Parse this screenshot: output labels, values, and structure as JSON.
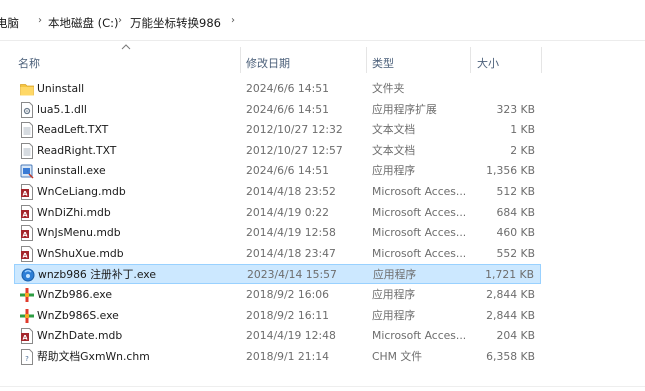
{
  "breadcrumb": [
    "电脑",
    "本地磁盘 (C:)",
    "万能坐标转换986"
  ],
  "columns": {
    "name": "名称",
    "date": "修改日期",
    "type": "类型",
    "size": "大小"
  },
  "files": [
    {
      "name": "Uninstall",
      "date": "2024/6/6 14:51",
      "type": "文件夹",
      "size": "",
      "icon": "folder-icon"
    },
    {
      "name": "lua5.1.dll",
      "date": "2024/6/6 14:51",
      "type": "应用程序扩展",
      "size": "323 KB",
      "icon": "dll-icon"
    },
    {
      "name": "ReadLeft.TXT",
      "date": "2012/10/27 12:32",
      "type": "文本文档",
      "size": "1 KB",
      "icon": "text-file-icon"
    },
    {
      "name": "ReadRight.TXT",
      "date": "2012/10/27 12:57",
      "type": "文本文档",
      "size": "2 KB",
      "icon": "text-file-icon"
    },
    {
      "name": "uninstall.exe",
      "date": "2024/6/6 14:51",
      "type": "应用程序",
      "size": "1,356 KB",
      "icon": "uninstaller-icon"
    },
    {
      "name": "WnCeLiang.mdb",
      "date": "2014/4/18 23:52",
      "type": "Microsoft Acces...",
      "size": "512 KB",
      "icon": "access-db-icon"
    },
    {
      "name": "WnDiZhi.mdb",
      "date": "2014/4/19 0:22",
      "type": "Microsoft Acces...",
      "size": "684 KB",
      "icon": "access-db-icon"
    },
    {
      "name": "WnJsMenu.mdb",
      "date": "2014/4/19 12:58",
      "type": "Microsoft Acces...",
      "size": "460 KB",
      "icon": "access-db-icon"
    },
    {
      "name": "WnShuXue.mdb",
      "date": "2014/4/18 23:47",
      "type": "Microsoft Acces...",
      "size": "552 KB",
      "icon": "access-db-icon"
    },
    {
      "name": "wnzb986 注册补丁.exe",
      "date": "2023/4/14 15:57",
      "type": "应用程序",
      "size": "1,721 KB",
      "icon": "patch-exe-icon",
      "selected": true
    },
    {
      "name": "WnZb986.exe",
      "date": "2018/9/2 16:06",
      "type": "应用程序",
      "size": "2,844 KB",
      "icon": "app-exe-icon"
    },
    {
      "name": "WnZb986S.exe",
      "date": "2018/9/2 16:11",
      "type": "应用程序",
      "size": "2,844 KB",
      "icon": "app-exe-icon"
    },
    {
      "name": "WnZhDate.mdb",
      "date": "2014/4/19 12:48",
      "type": "Microsoft Acces...",
      "size": "204 KB",
      "icon": "access-db-icon"
    },
    {
      "name": "帮助文档GxmWn.chm",
      "date": "2018/9/1 21:14",
      "type": "CHM 文件",
      "size": "6,358 KB",
      "icon": "chm-help-icon"
    }
  ],
  "colors": {
    "selection_bg": "#cce8ff",
    "selection_border": "#99d1ff",
    "header_text": "#4c607a"
  }
}
